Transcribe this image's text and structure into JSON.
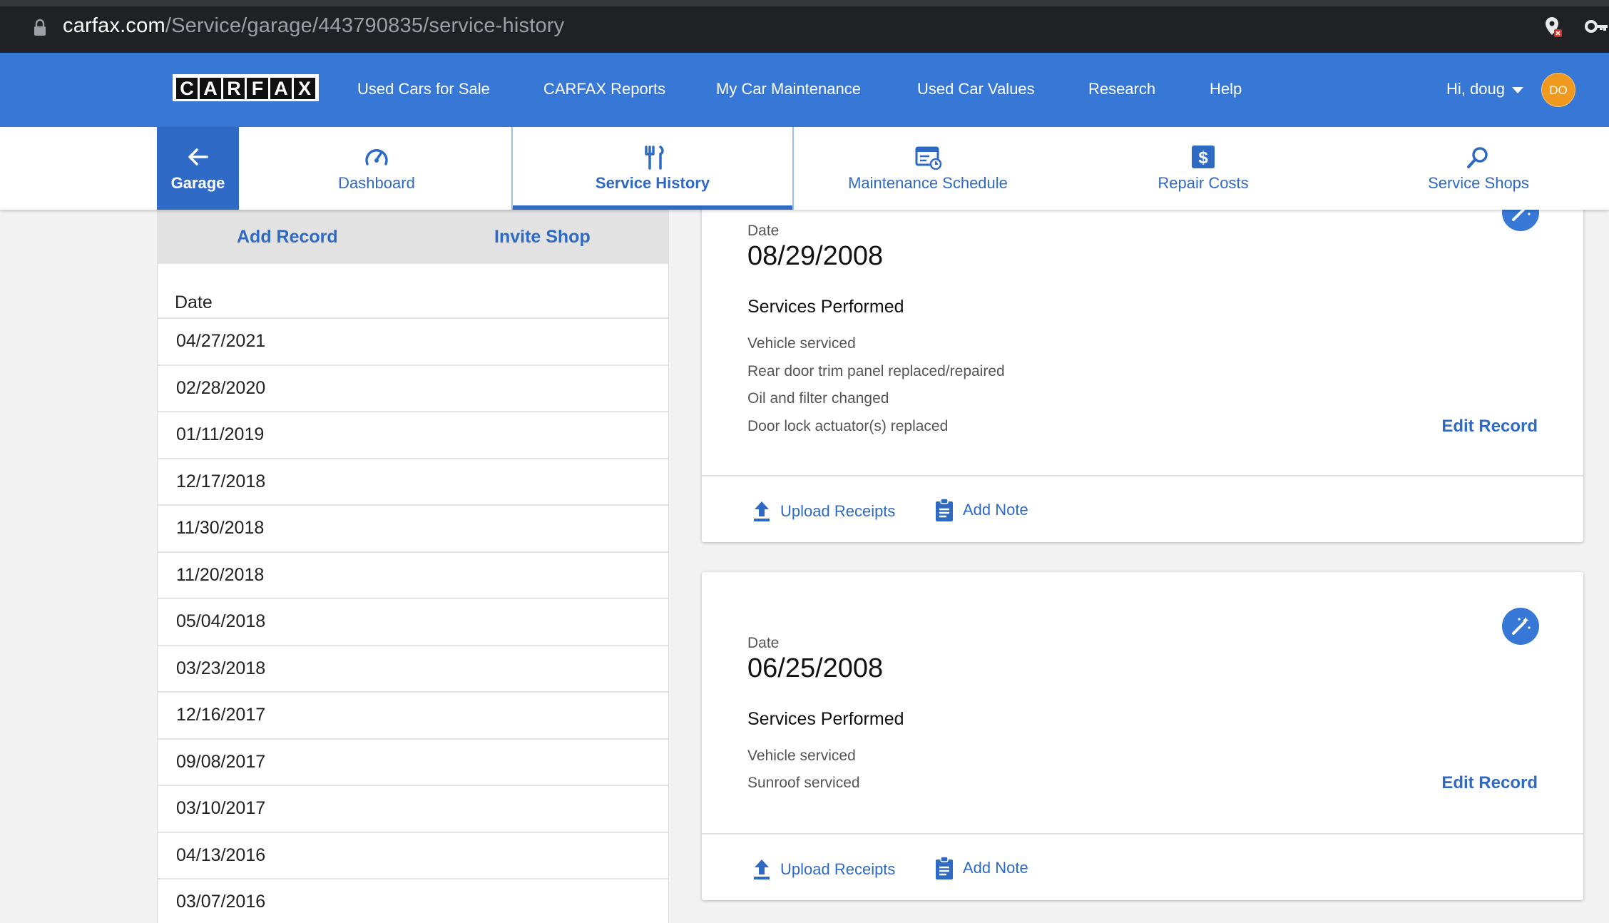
{
  "browser": {
    "url_host": "carfax.com",
    "url_path": "/Service/garage/443790835/service-history"
  },
  "header": {
    "logo_letters": [
      "C",
      "A",
      "R",
      "F",
      "A",
      "X"
    ],
    "nav": [
      "Used Cars for Sale",
      "CARFAX Reports",
      "My Car Maintenance",
      "Used Car Values",
      "Research",
      "Help"
    ],
    "greeting": "Hi, doug",
    "avatar_initials": "DO",
    "brand_color": "#3777d6",
    "avatar_color": "#ef9a1e"
  },
  "tabs": {
    "garage": "Garage",
    "items": [
      {
        "label": "Dashboard",
        "icon": "speedometer-icon"
      },
      {
        "label": "Service History",
        "icon": "tools-icon",
        "active": true
      },
      {
        "label": "Maintenance Schedule",
        "icon": "schedule-icon"
      },
      {
        "label": "Repair Costs",
        "icon": "dollar-icon"
      },
      {
        "label": "Service Shops",
        "icon": "search-icon"
      }
    ]
  },
  "left_panel": {
    "add_record": "Add Record",
    "invite_shop": "Invite Shop",
    "list_header": "Date",
    "dates": [
      "04/27/2021",
      "02/28/2020",
      "01/11/2019",
      "12/17/2018",
      "11/30/2018",
      "11/20/2018",
      "05/04/2018",
      "03/23/2018",
      "12/16/2017",
      "09/08/2017",
      "03/10/2017",
      "04/13/2016",
      "03/07/2016"
    ]
  },
  "records": [
    {
      "date_label": "Date",
      "date": "08/29/2008",
      "services_title": "Services Performed",
      "services": [
        "Vehicle serviced",
        "Rear door trim panel replaced/repaired",
        "Oil and filter changed",
        "Door lock actuator(s) replaced"
      ],
      "edit": "Edit Record",
      "upload": "Upload Receipts",
      "note": "Add Note"
    },
    {
      "date_label": "Date",
      "date": "06/25/2008",
      "services_title": "Services Performed",
      "services": [
        "Vehicle serviced",
        "Sunroof serviced"
      ],
      "edit": "Edit Record",
      "upload": "Upload Receipts",
      "note": "Add Note"
    }
  ]
}
